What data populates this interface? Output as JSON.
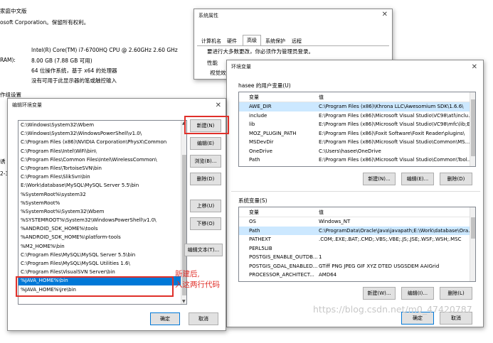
{
  "bg": {
    "edition": "家庭中文版",
    "copyright": "osoft Corporation。保留所有权利。",
    "cpu_value": "Intel(R) Core(TM) i7-6700HQ CPU @ 2.60GHz   2.60 GHz",
    "ram_label": "RAM):",
    "ram_value": "8.00 GB (7.88 GB 可用)",
    "systype_value": "64 位操作系统，基于 x64 的处理器",
    "pen_value": "没有可用于此显示器的笔或触控输入",
    "workgroup": "作组设置",
    "frag1": "诱",
    "frag2": "2-3"
  },
  "sysprops": {
    "title": "系统属性",
    "tabs": [
      "计算机名",
      "硬件",
      "高级",
      "系统保护",
      "远程"
    ],
    "notice": "要进行大多数更改，你必须作为管理员登录。",
    "perf": "性能",
    "visual": "视觉效果"
  },
  "envvars": {
    "title": "环境变量",
    "user_group": "hasee 的用户变量(U)",
    "col_var": "变量",
    "col_val": "值",
    "user_rows": [
      {
        "name": "AWE_DIR",
        "value": "C:\\Program Files (x86)\\Khrona LLC\\Awesomium SDK\\1.6.6\\"
      },
      {
        "name": "include",
        "value": "E:\\Program Files (x86)\\Microsoft Visual Studio\\VC98\\atl\\inclu..."
      },
      {
        "name": "lib",
        "value": "E:\\Program Files (x86)\\Microsoft Visual Studio\\VC98\\mfc\\lib;E..."
      },
      {
        "name": "MOZ_PLUGIN_PATH",
        "value": "E:\\Program Files (x86)\\Foxit Software\\Foxit Reader\\plugins\\"
      },
      {
        "name": "MSDevDir",
        "value": "E:\\Program Files (x86)\\Microsoft Visual Studio\\Common\\MS..."
      },
      {
        "name": "OneDrive",
        "value": "C:\\Users\\hasee\\OneDrive"
      },
      {
        "name": "Path",
        "value": "E:\\Program Files (x86)\\Microsoft Visual Studio\\Common\\Tool..."
      }
    ],
    "user_new": "新建(N)...",
    "user_edit": "编辑(E)...",
    "user_delete": "删除(D)",
    "sys_group": "系统变量(S)",
    "sys_rows": [
      {
        "name": "OS",
        "value": "Windows_NT"
      },
      {
        "name": "Path",
        "value": "C:\\ProgramData\\Oracle\\Java\\javapath;E:\\Work\\database\\Ora..."
      },
      {
        "name": "PATHEXT",
        "value": ".COM;.EXE;.BAT;.CMD;.VBS;.VBE;.JS;.JSE;.WSF;.WSH;.MSC"
      },
      {
        "name": "PERL5LIB",
        "value": ""
      },
      {
        "name": "POSTGIS_ENABLE_OUTDB...",
        "value": "1"
      },
      {
        "name": "POSTGIS_GDAL_ENABLED...",
        "value": "GTiff PNG JPEG GIF XYZ DTED USGSDEM AAIGrid"
      },
      {
        "name": "PROCESSOR_ARCHITECT...",
        "value": "AMD64"
      }
    ],
    "sys_new": "新建(W)...",
    "sys_edit": "编辑(I)...",
    "sys_delete": "删除(L)",
    "ok": "确定",
    "cancel": "取消"
  },
  "editenv": {
    "title": "编辑环境变量",
    "items": [
      "C:\\Windows\\System32\\Wbem",
      "C:\\Windows\\System32\\WindowsPowerShell\\v1.0\\",
      "C:\\Program Files (x86)\\NVIDIA Corporation\\PhysX\\Common",
      "C:\\Program Files\\Intel\\WiFi\\bin\\",
      "C:\\Program Files\\Common Files\\Intel\\WirelessCommon\\",
      "C:\\Program Files\\TortoiseSVN\\bin",
      "C:\\Program Files\\SlikSvn\\bin",
      "E:\\Work\\database\\MySQL\\MySQL Server 5.5\\bin",
      "%SystemRoot%\\system32",
      "%SystemRoot%",
      "%SystemRoot%\\System32\\Wbem",
      "%SYSTEMROOT%\\System32\\WindowsPowerShell\\v1.0\\",
      "%ANDROID_SDK_HOME%\\tools",
      "%ANDROID_SDK_HOME%\\platform-tools",
      "%M2_HOME%\\bin",
      "C:\\Program Files\\MySQL\\MySQL Server 5.5\\bin",
      "C:\\Program Files\\MySQL\\MySQL Utilities 1.6\\",
      "C:\\Program Files\\VisualSVN Server\\bin",
      "%JAVA_HOME%\\bin",
      "%JAVA_HOME%\\jre\\bin"
    ],
    "btn_new": "新建(N)",
    "btn_edit": "编辑(E)",
    "btn_browse": "浏览(B)...",
    "btn_delete": "删除(D)",
    "btn_up": "上移(U)",
    "btn_down": "下移(O)",
    "btn_edit_text": "编辑文本(T)...",
    "ok": "确定",
    "cancel": "取消"
  },
  "annotation": {
    "line1": "新建后,",
    "line2": "入这两行代码"
  },
  "watermark": "https://blog.csdn.net/m0_47420787",
  "colors": {
    "accent": "#0078d7",
    "highlight": "#e0302a"
  }
}
